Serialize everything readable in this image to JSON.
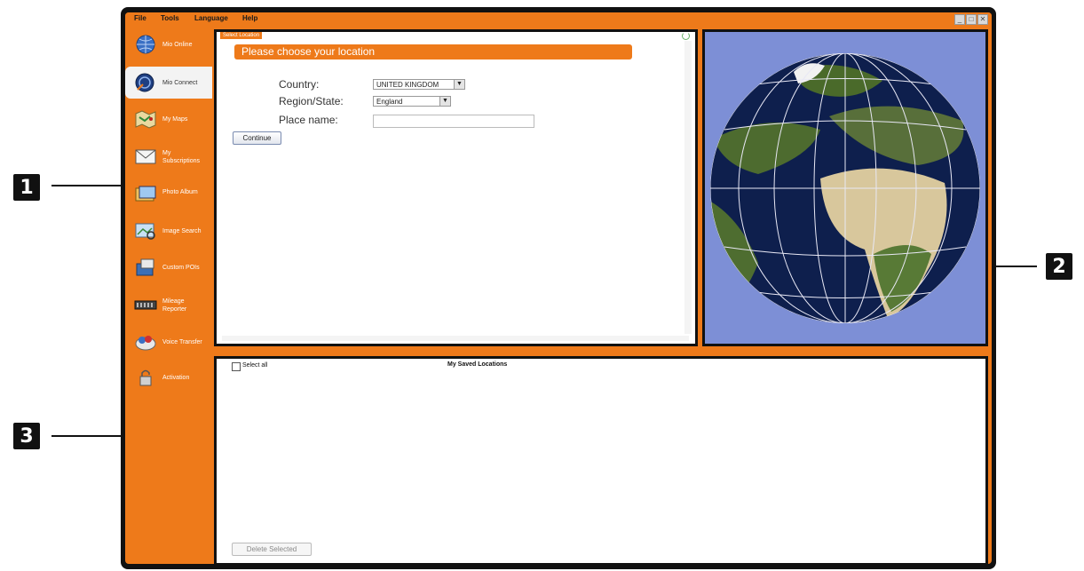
{
  "callouts": [
    "1",
    "2",
    "3"
  ],
  "menu": [
    "File",
    "Tools",
    "Language",
    "Help"
  ],
  "window_controls": [
    "_",
    "□",
    "✕"
  ],
  "sidebar": {
    "items": [
      {
        "label": "Mio Online",
        "icon": "globe-icon"
      },
      {
        "label": "Mio Connect",
        "icon": "connect-globe-icon"
      },
      {
        "label": "My Maps",
        "icon": "map-icon"
      },
      {
        "label": "My Subscriptions",
        "icon": "subscriptions-icon"
      },
      {
        "label": "Photo Album",
        "icon": "photo-album-icon"
      },
      {
        "label": "Image Search",
        "icon": "image-search-icon"
      },
      {
        "label": "Custom POIs",
        "icon": "custom-poi-icon"
      },
      {
        "label": "Mileage Reporter",
        "icon": "mileage-icon"
      },
      {
        "label": "Voice Transfer",
        "icon": "voice-transfer-icon"
      },
      {
        "label": "Activation",
        "icon": "activation-icon"
      }
    ]
  },
  "location_panel": {
    "tab_label": "Select Location",
    "header": "Please choose your location",
    "country_label": "Country:",
    "country_value": "UNITED KINGDOM",
    "region_label": "Region/State:",
    "region_value": "England",
    "place_label": "Place name:",
    "place_value": "",
    "continue_label": "Continue"
  },
  "saved_panel": {
    "select_all_label": "Select all",
    "title": "My Saved Locations",
    "delete_label": "Delete Selected"
  },
  "colors": {
    "accent": "#ee7a1a",
    "globe_background": "#7d8fd6",
    "frame": "#111111"
  }
}
